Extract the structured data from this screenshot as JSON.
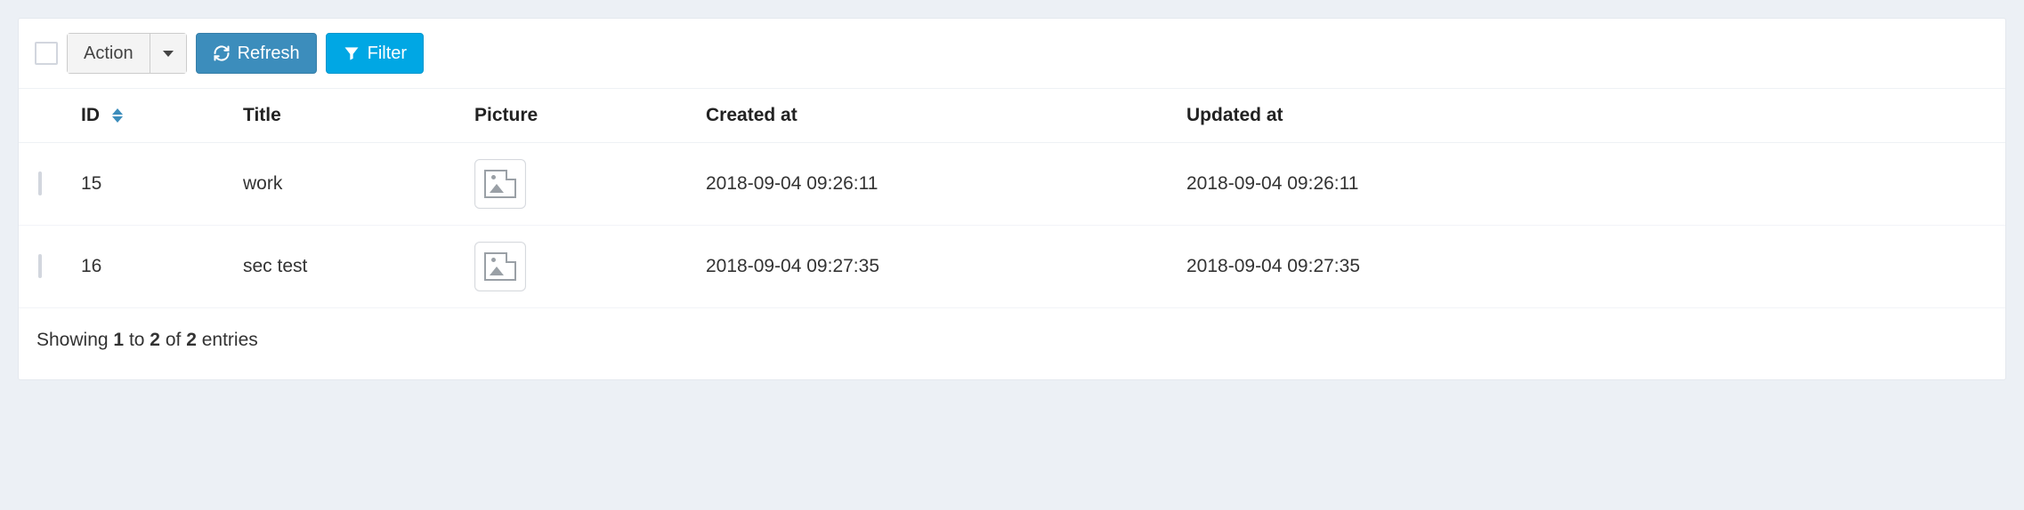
{
  "toolbar": {
    "action_label": "Action",
    "refresh_label": "Refresh",
    "filter_label": "Filter"
  },
  "table": {
    "columns": {
      "id": "ID",
      "title": "Title",
      "picture": "Picture",
      "created_at": "Created at",
      "updated_at": "Updated at"
    },
    "rows": [
      {
        "id": "15",
        "title": "work",
        "created_at": "2018-09-04 09:26:11",
        "updated_at": "2018-09-04 09:26:11"
      },
      {
        "id": "16",
        "title": "sec test",
        "created_at": "2018-09-04 09:27:35",
        "updated_at": "2018-09-04 09:27:35"
      }
    ]
  },
  "footer": {
    "prefix": "Showing",
    "from": "1",
    "to_word": "to",
    "to": "2",
    "of_word": "of",
    "total": "2",
    "suffix": "entries"
  },
  "colors": {
    "primary": "#3c8dbc",
    "info": "#00a7e4",
    "page_bg": "#ecf0f5"
  }
}
